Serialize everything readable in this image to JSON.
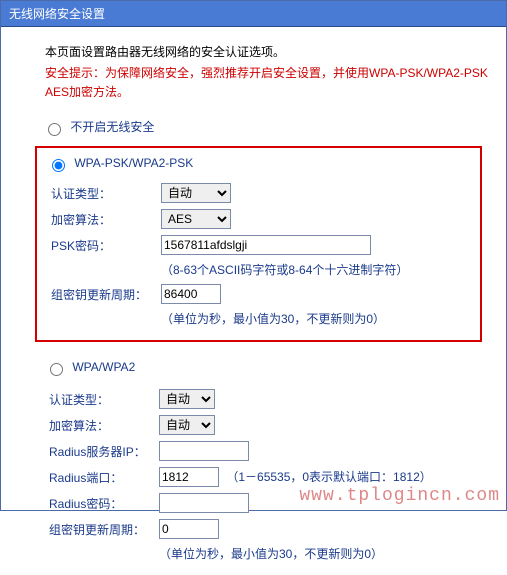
{
  "title": "无线网络安全设置",
  "intro": "本页面设置路由器无线网络的安全认证选项。",
  "warning": "安全提示：为保障网络安全，强烈推荐开启安全设置，并使用WPA-PSK/WPA2-PSK AES加密方法。",
  "radio_none": "不开启无线安全",
  "radio_wpapsk": "WPA-PSK/WPA2-PSK",
  "radio_wpa": "WPA/WPA2",
  "labels": {
    "auth_type": "认证类型：",
    "encrypt": "加密算法：",
    "psk_pwd": "PSK密码：",
    "group_key": "组密钥更新周期：",
    "radius_ip": "Radius服务器IP：",
    "radius_port": "Radius端口：",
    "radius_pwd": "Radius密码："
  },
  "wpapsk": {
    "auth_type": "自动",
    "encrypt": "AES",
    "psk_value": "1567811afdslgji",
    "psk_hint": "（8-63个ASCII码字符或8-64个十六进制字符）",
    "group_key_value": "86400",
    "group_key_hint": "（单位为秒，最小值为30，不更新则为0）"
  },
  "wpa": {
    "auth_type": "自动",
    "encrypt": "自动",
    "radius_ip": "",
    "radius_port": "1812",
    "radius_port_hint": "（1－65535，0表示默认端口：1812）",
    "radius_pwd": "",
    "group_key_value": "0",
    "group_key_hint": "（单位为秒，最小值为30，不更新则为0）"
  },
  "watermark": "www.tplogincn.com"
}
